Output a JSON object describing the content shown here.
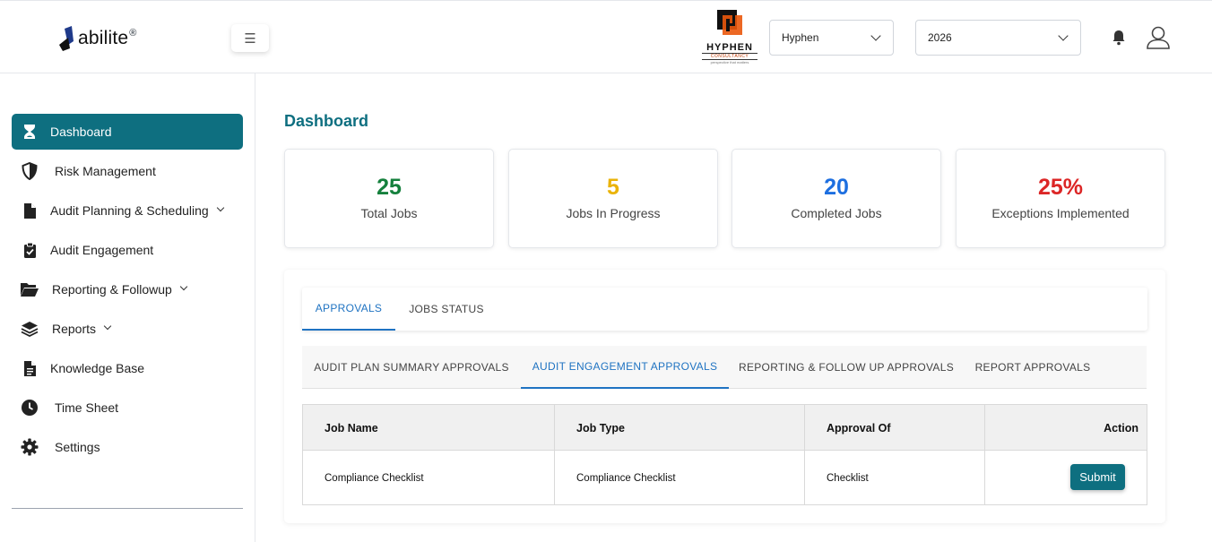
{
  "header": {
    "logo_text": "abilite",
    "logo_reg": "®",
    "menu_icon": "hamburger-icon",
    "brand": {
      "name": "HYPHEN",
      "sub": "CONSULTANCY",
      "tag": "perspective that matters"
    },
    "org_select": {
      "value": "Hyphen"
    },
    "year_select": {
      "value": "2026"
    },
    "bell_icon": "bell-icon",
    "user_icon": "user-icon"
  },
  "sidebar": {
    "items": [
      {
        "label": "Dashboard",
        "icon": "hourglass-icon",
        "active": true,
        "caret": false
      },
      {
        "label": "Risk Management",
        "icon": "shield-icon",
        "active": false,
        "caret": false
      },
      {
        "label": "Audit Planning & Scheduling",
        "icon": "file-icon",
        "active": false,
        "caret": true
      },
      {
        "label": "Audit Engagement",
        "icon": "clipboard-check-icon",
        "active": false,
        "caret": false
      },
      {
        "label": "Reporting & Followup",
        "icon": "folder-open-icon",
        "active": false,
        "caret": true
      },
      {
        "label": "Reports",
        "icon": "layers-icon",
        "active": false,
        "caret": true
      },
      {
        "label": "Knowledge Base",
        "icon": "document-icon",
        "active": false,
        "caret": false
      },
      {
        "label": "Time Sheet",
        "icon": "clock-icon",
        "active": false,
        "caret": false
      },
      {
        "label": "Settings",
        "icon": "gear-icon",
        "active": false,
        "caret": false
      }
    ]
  },
  "main": {
    "title": "Dashboard",
    "stats": [
      {
        "value": "25",
        "label": "Total Jobs",
        "color": "#15803d"
      },
      {
        "value": "5",
        "label": "Jobs In Progress",
        "color": "#eab308"
      },
      {
        "value": "20",
        "label": "Completed Jobs",
        "color": "#1d6fe0"
      },
      {
        "value": "25%",
        "label": "Exceptions Implemented",
        "color": "#dc2626"
      }
    ],
    "tabs": [
      {
        "label": "APPROVALS",
        "active": true
      },
      {
        "label": "JOBS STATUS",
        "active": false
      }
    ],
    "subtabs": [
      {
        "label": "AUDIT PLAN SUMMARY APPROVALS",
        "active": false
      },
      {
        "label": "AUDIT ENGAGEMENT APPROVALS",
        "active": true
      },
      {
        "label": "REPORTING & FOLLOW UP APPROVALS",
        "active": false
      },
      {
        "label": "REPORT APPROVALS",
        "active": false
      }
    ],
    "table": {
      "headers": [
        "Job Name",
        "Job Type",
        "Approval Of",
        "Action"
      ],
      "rows": [
        {
          "job_name": "Compliance Checklist",
          "job_type": "Compliance Checklist",
          "approval_of": "Checklist",
          "action": "Submit"
        }
      ]
    }
  },
  "colors": {
    "accent": "#0e6f80",
    "tab_active": "#1f73c2"
  }
}
